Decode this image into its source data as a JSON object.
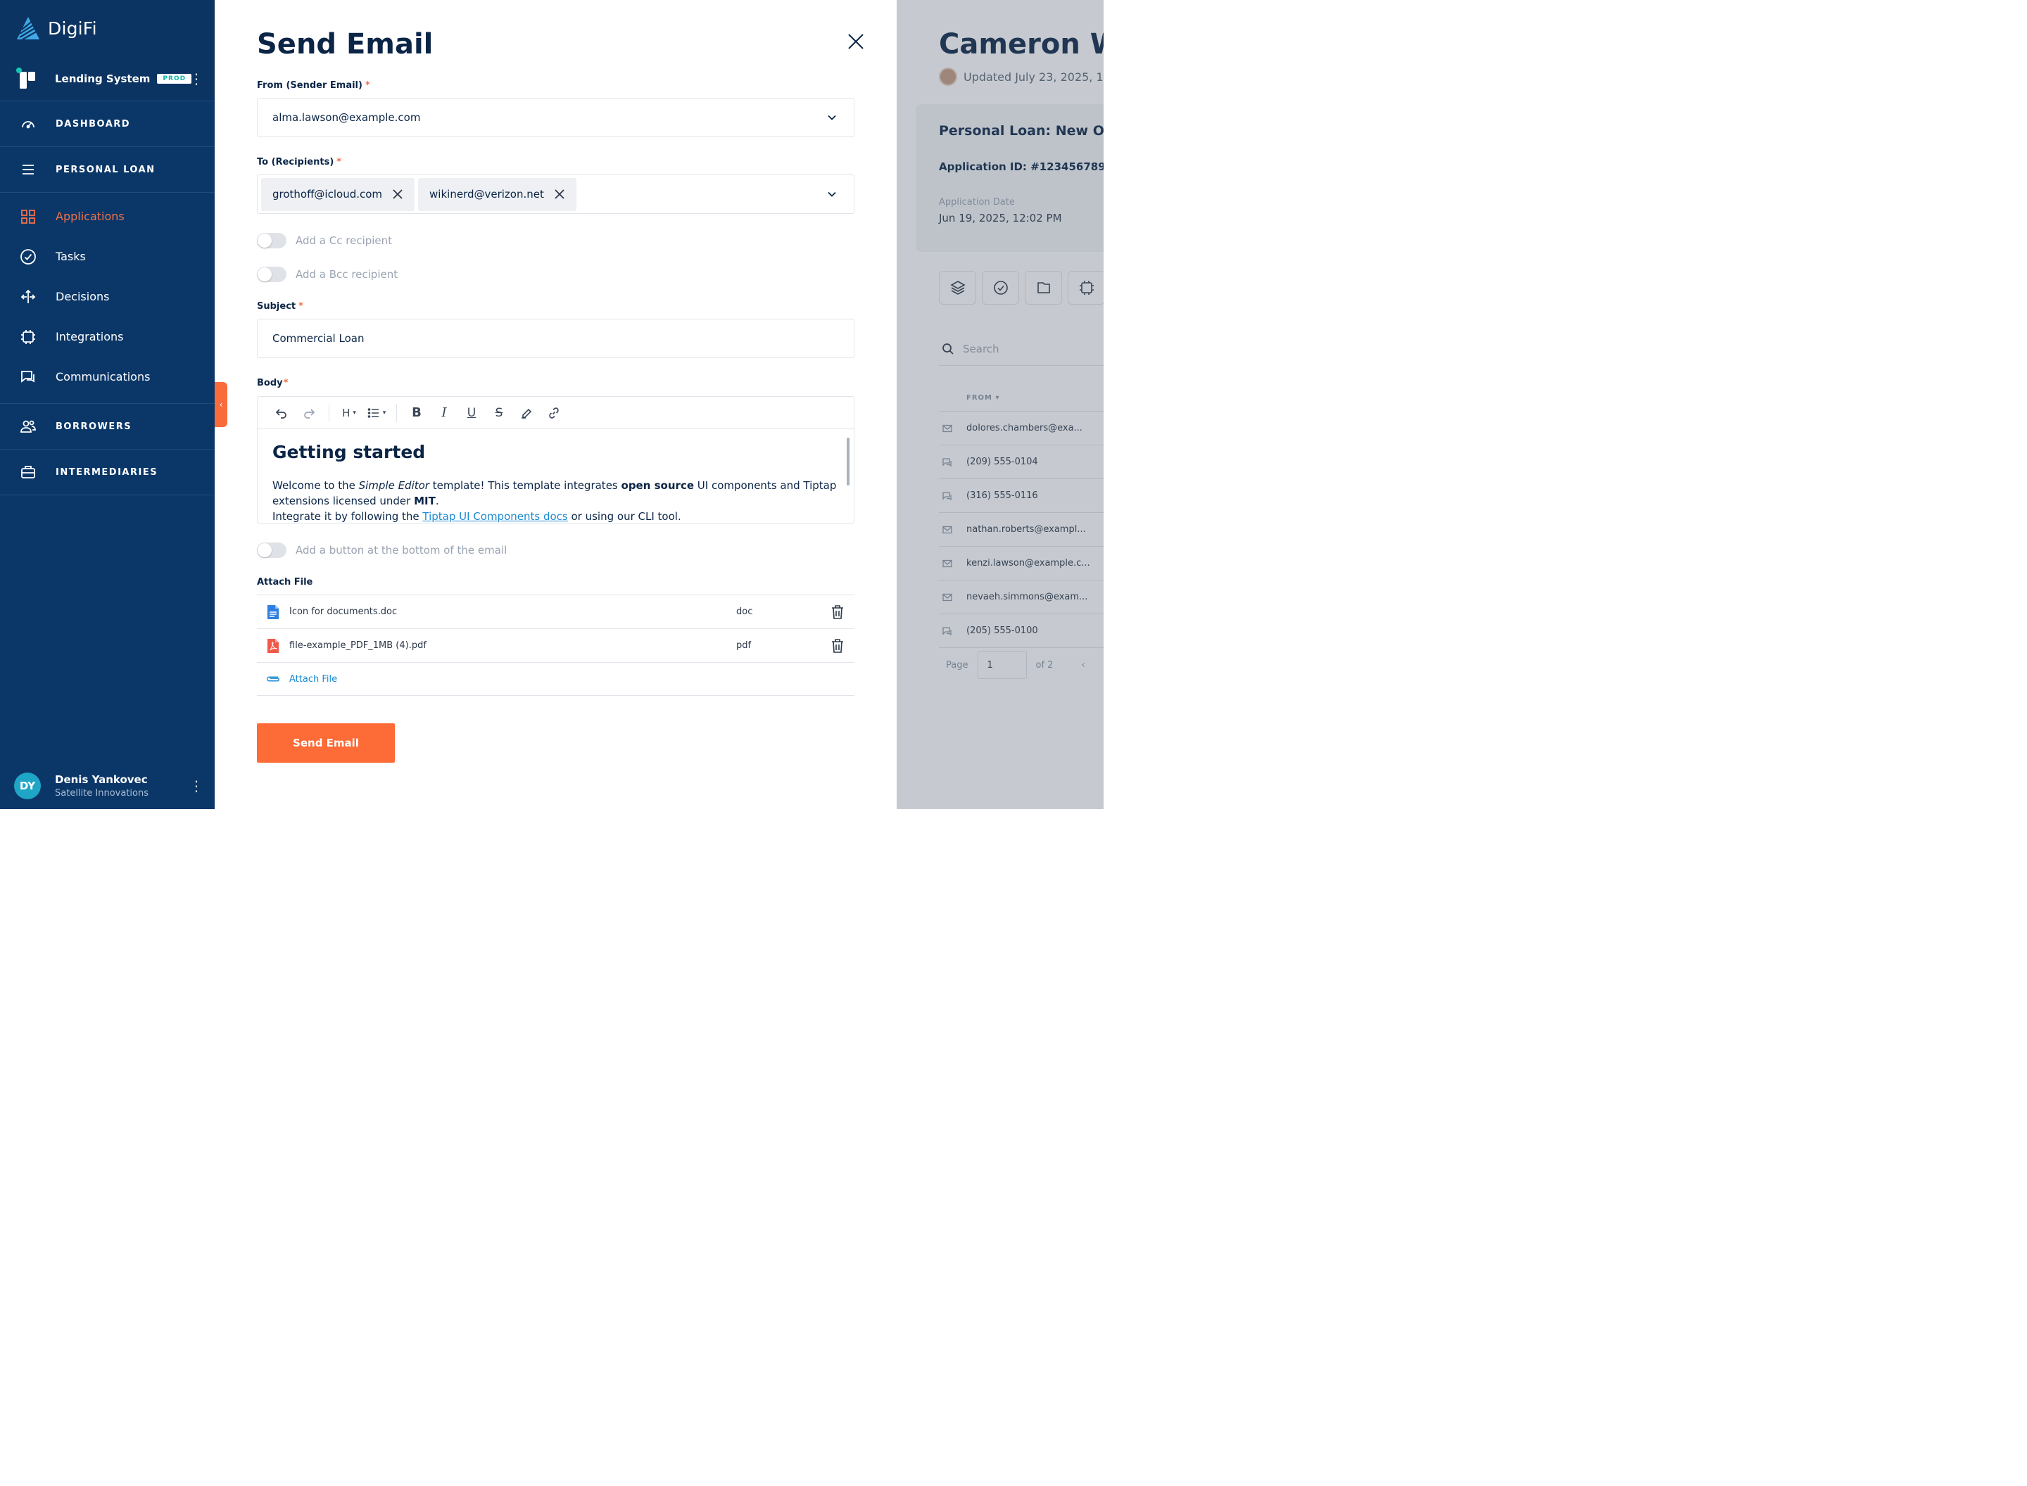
{
  "brand": {
    "name": "DigiFi"
  },
  "system": {
    "name": "Lending System",
    "env": "PROD"
  },
  "nav": {
    "dashboard": "DASHBOARD",
    "personal_loan": "PERSONAL LOAN",
    "items": [
      {
        "label": "Applications",
        "icon": "grid-icon",
        "active": true
      },
      {
        "label": "Tasks",
        "icon": "check-circle-icon"
      },
      {
        "label": "Decisions",
        "icon": "decision-arrows-icon"
      },
      {
        "label": "Integrations",
        "icon": "chip-icon"
      },
      {
        "label": "Communications",
        "icon": "chat-icon"
      }
    ],
    "borrowers": "BORROWERS",
    "intermediaries": "INTERMEDIARIES"
  },
  "user": {
    "initials": "DY",
    "name": "Denis Yankovec",
    "org": "Satellite Innovations"
  },
  "modal": {
    "title": "Send Email",
    "from_label": "From (Sender Email)",
    "from_value": "alma.lawson@example.com",
    "to_label": "To (Recipients)",
    "recipients": [
      "grothoff@icloud.com",
      "wikinerd@verizon.net"
    ],
    "cc_toggle": "Add a Cc recipient",
    "bcc_toggle": "Add a Bcc recipient",
    "subject_label": "Subject",
    "subject_value": "Commercial Loan",
    "body_label": "Body",
    "editor": {
      "heading_btn": "H",
      "heading": "Getting started",
      "p1_a": "Welcome to the ",
      "p1_em": "Simple Editor",
      "p1_b": " template! This template integrates ",
      "p1_strong": "open source",
      "p1_c": " UI components and Tiptap extensions licensed under ",
      "p1_mit": "MIT",
      "p1_d": ".",
      "p2_a": "Integrate it by following the ",
      "p2_link": "Tiptap UI Components docs",
      "p2_b": " or using our CLI tool."
    },
    "button_toggle": "Add a button at the bottom of the email",
    "attach_label": "Attach File",
    "files": [
      {
        "name": "Icon for documents.doc",
        "type": "doc",
        "color": "#2f7fe0"
      },
      {
        "name": "file-example_PDF_1MB (4).pdf",
        "type": "pdf",
        "color": "#f0584a"
      }
    ],
    "attach_link": "Attach File",
    "send_button": "Send Email"
  },
  "background": {
    "title": "Cameron W",
    "updated": "Updated July 23, 2025, 1",
    "card_title": "Personal Loan: New Op",
    "app_id": "Application ID: #123456789",
    "date_label": "Application Date",
    "date_value": "Jun 19, 2025, 12:02 PM",
    "search_placeholder": "Search",
    "column_from": "FROM",
    "rows": [
      {
        "kind": "email",
        "text": "dolores.chambers@exa..."
      },
      {
        "kind": "sms",
        "text": "(209) 555-0104"
      },
      {
        "kind": "sms",
        "text": "(316) 555-0116"
      },
      {
        "kind": "email",
        "text": "nathan.roberts@exampl..."
      },
      {
        "kind": "email",
        "text": "kenzi.lawson@example.c..."
      },
      {
        "kind": "email",
        "text": "nevaeh.simmons@exam..."
      },
      {
        "kind": "sms",
        "text": "(205) 555-0100"
      }
    ],
    "page_label": "Page",
    "page_value": "1",
    "page_of": "of 2"
  },
  "colors": {
    "sidebar": "#0b3768",
    "accent": "#fd6b36",
    "link": "#1b8ad1",
    "env_badge": "#15b4a7"
  }
}
